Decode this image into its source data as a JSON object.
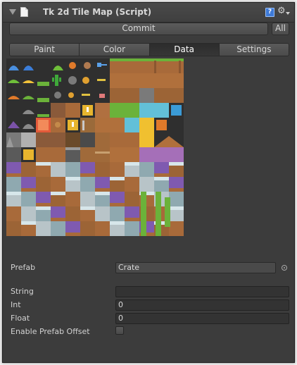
{
  "header": {
    "title": "Tk 2d Tile Map (Script)",
    "help_icon": "?"
  },
  "toolbar": {
    "commit_label": "Commit",
    "all_label": "All"
  },
  "tabs": [
    {
      "label": "Paint",
      "active": false
    },
    {
      "label": "Color",
      "active": false
    },
    {
      "label": "Data",
      "active": true
    },
    {
      "label": "Settings",
      "active": false
    }
  ],
  "properties": {
    "prefab": {
      "label": "Prefab",
      "value": "Crate"
    },
    "string": {
      "label": "String",
      "value": ""
    },
    "int": {
      "label": "Int",
      "value": "0"
    },
    "float": {
      "label": "Float",
      "value": "0"
    },
    "enable_prefab_offset": {
      "label": "Enable Prefab Offset",
      "checked": false
    }
  },
  "colors": {
    "panel_bg": "#3c3c3c",
    "active_tab": "#2c2c2c",
    "field_bg": "#333333",
    "accent_blue": "#3e7ad8"
  }
}
